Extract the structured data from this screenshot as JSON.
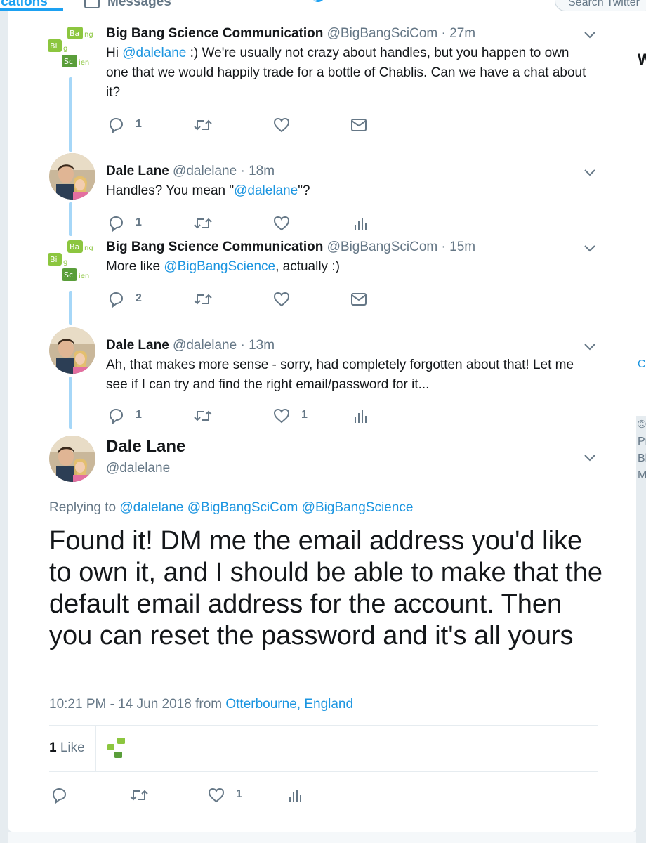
{
  "nav": {
    "notifications_label": "ications",
    "messages_label": "Messages",
    "search_placeholder": "Search Twitter"
  },
  "thread": [
    {
      "author_name": "Big Bang Science Communication",
      "handle": "@BigBangSciCom",
      "separator": "·",
      "time": "27m",
      "text_before": "Hi ",
      "mention": "@dalelane",
      "text_after": " :) We're usually not crazy about handles, but you happen to own one that we would happily trade for a bottle of Chablis. Can we have a chat about it?",
      "reply_count": "1",
      "like_count": ""
    },
    {
      "author_name": "Dale Lane",
      "handle": "@dalelane",
      "separator": "·",
      "time": "18m",
      "text_before": "Handles? You mean \"",
      "mention": "@dalelane",
      "text_after": "\"?",
      "reply_count": "1",
      "like_count": ""
    },
    {
      "author_name": "Big Bang Science Communication",
      "handle": "@BigBangSciCom",
      "separator": "·",
      "time": "15m",
      "text_before": "More like ",
      "mention": "@BigBangScience",
      "text_after": ", actually :)",
      "reply_count": "2",
      "like_count": ""
    },
    {
      "author_name": "Dale Lane",
      "handle": "@dalelane",
      "separator": "·",
      "time": "13m",
      "text_before": "Ah, that makes more sense - sorry, had completely forgotten about that! Let me see if I can try and find the right email/password for it...",
      "mention": "",
      "text_after": "",
      "reply_count": "1",
      "like_count": "1"
    }
  ],
  "main_tweet": {
    "author_name": "Dale Lane",
    "handle": "@dalelane",
    "replying_prefix": "Replying to",
    "replying_to": "@dalelane @BigBangSciCom @BigBangScience",
    "text": "Found it! DM me the email address you'd like to own it, and I should be able to make that the default email address for the account. Then you can reset the password and it's all yours",
    "timestamp": "10:21 PM - 14 Jun 2018",
    "from_label": "from",
    "location": "Otterbourne, England",
    "likes_count": "1",
    "likes_label": "Like",
    "like_count": "1"
  },
  "logo_text": {
    "ba": "Ba",
    "ng": "ng",
    "bi": "Bi",
    "g": "g",
    "sc": "Sc",
    "ien": "ien"
  },
  "side_text": {
    "w": "W",
    "c": "C",
    "copy": "©",
    "p": "Pr",
    "b": "Bl",
    "m": "M"
  },
  "colors": {
    "link": "#1b95e0",
    "thread_line": "#a6d7f8",
    "muted": "#657786",
    "logo_green": "#8cc63f"
  }
}
